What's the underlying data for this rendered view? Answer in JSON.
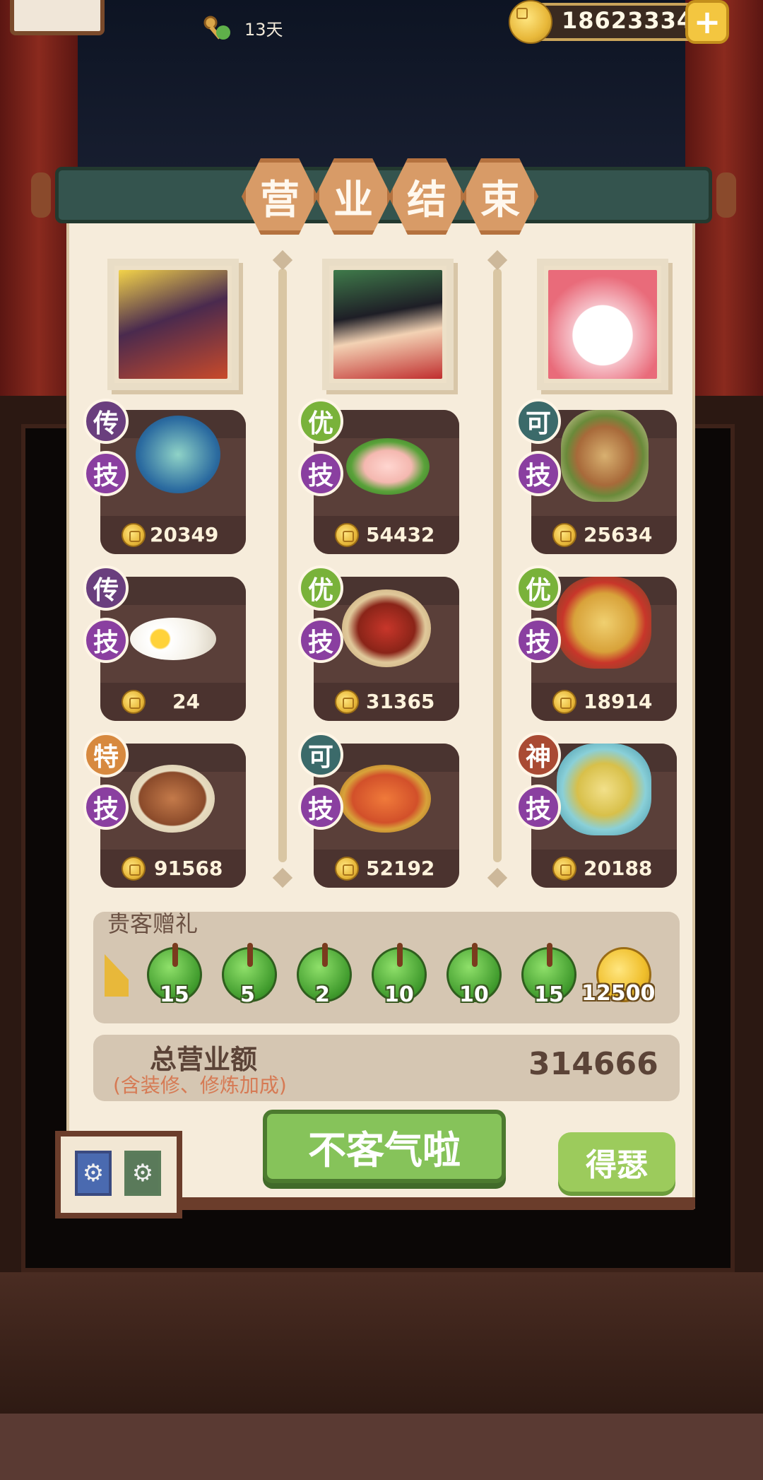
{
  "hud": {
    "days_label": "13天",
    "coins": "18623334",
    "icons": {
      "days": "calendar-key-icon",
      "coin": "coin-icon",
      "add": "plus-icon"
    }
  },
  "title": {
    "chars": [
      "营",
      "业",
      "结",
      "束"
    ]
  },
  "customers": [
    {
      "avatar": "dark-haired-hero-avatar",
      "accent": "#3a2a44",
      "dishes": [
        {
          "grade": "传",
          "skill": "技",
          "price": "20349"
        },
        {
          "grade": "传",
          "skill": "技",
          "price": "24"
        },
        {
          "grade": "特",
          "skill": "技",
          "price": "91568"
        }
      ]
    },
    {
      "avatar": "boy-with-red-cap-avatar",
      "accent": "#2f5a3a",
      "dishes": [
        {
          "grade": "优",
          "skill": "技",
          "price": "54432"
        },
        {
          "grade": "优",
          "skill": "技",
          "price": "31365"
        },
        {
          "grade": "可",
          "skill": "技",
          "price": "52192"
        }
      ]
    },
    {
      "avatar": "hello-kitty-avatar",
      "accent": "#e96b7a",
      "dishes": [
        {
          "grade": "可",
          "skill": "技",
          "price": "25634"
        },
        {
          "grade": "优",
          "skill": "技",
          "price": "18914"
        },
        {
          "grade": "神",
          "skill": "技",
          "price": "20188"
        }
      ]
    }
  ],
  "gifts": {
    "title": "贵客赠礼",
    "items": [
      "15",
      "5",
      "2",
      "10",
      "10",
      "15"
    ],
    "coin_amount": "12500"
  },
  "total": {
    "label": "总营业额",
    "note": "(含装修、修炼加成)",
    "value": "314666"
  },
  "buttons": {
    "ok": "不客气啦",
    "brag": "得瑟"
  },
  "hall_tiles": [
    "⚙",
    "⚙"
  ]
}
